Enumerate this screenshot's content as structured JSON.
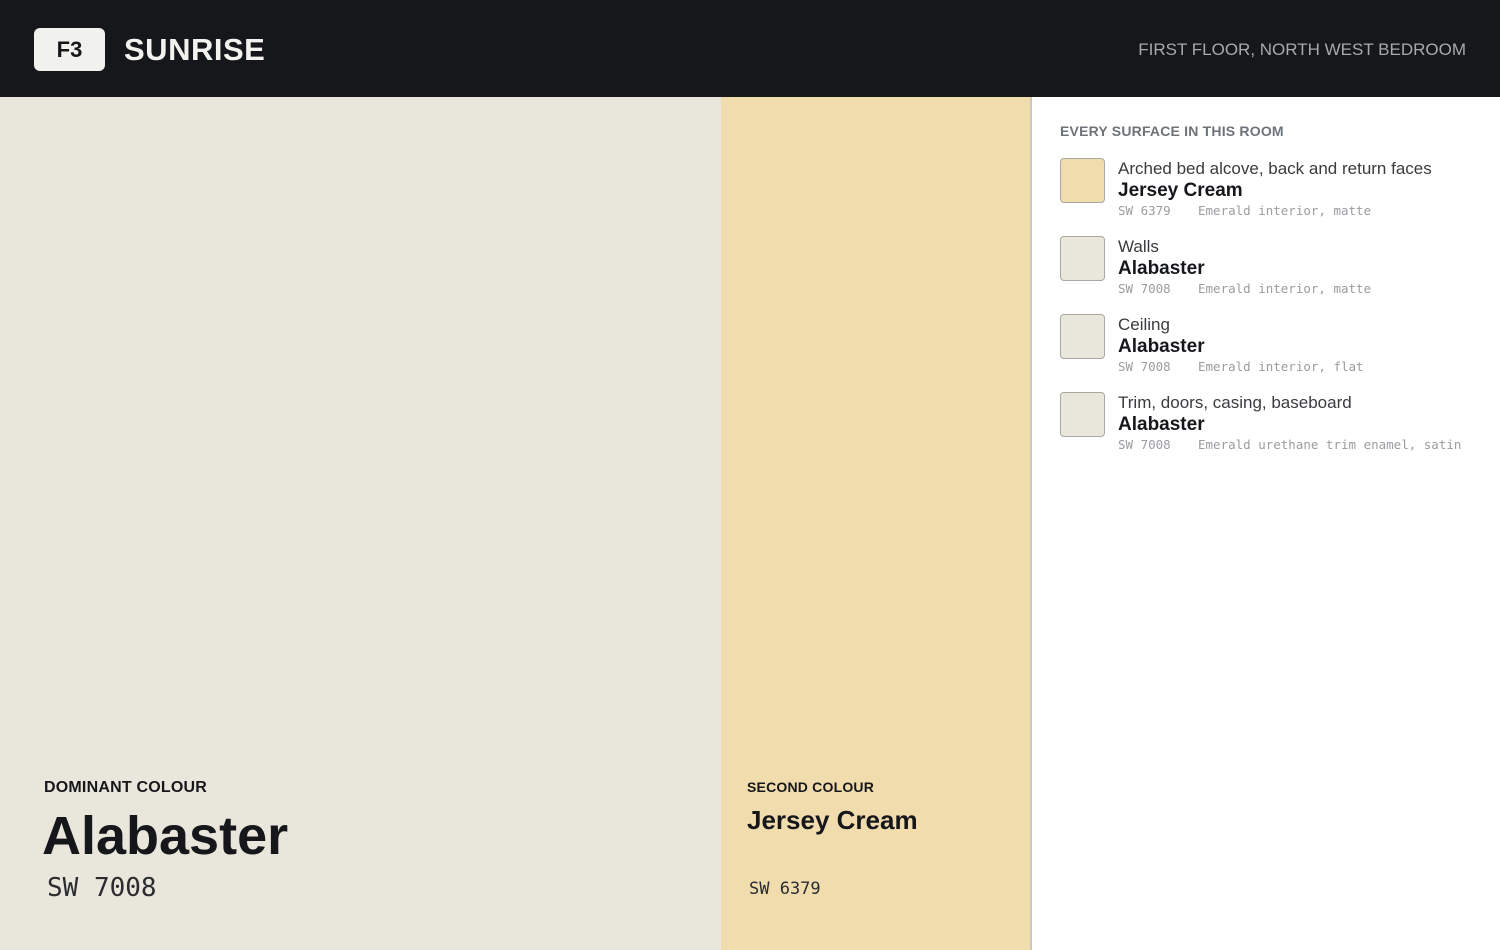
{
  "header": {
    "floor_badge": "F3",
    "app_title": "SUNRISE",
    "location": "FIRST FLOOR, NORTH WEST BEDROOM"
  },
  "dominant": {
    "kicker": "DOMINANT COLOUR",
    "name": "Alabaster",
    "code": "SW 7008",
    "color": "#e9e6dc"
  },
  "second": {
    "kicker": "SECOND COLOUR",
    "name": "Jersey Cream",
    "code": "SW 6379",
    "color": "#f0dcad"
  },
  "panel": {
    "heading": "EVERY SURFACE IN THIS ROOM",
    "surfaces": [
      {
        "label": "Arched bed alcove, back and return faces",
        "colour_name": "Jersey Cream",
        "code": "SW 6379",
        "finish": "Emerald interior, matte",
        "swatch_color": "#f0dcad"
      },
      {
        "label": "Walls",
        "colour_name": "Alabaster",
        "code": "SW 7008",
        "finish": "Emerald interior, matte",
        "swatch_color": "#e9e6dc"
      },
      {
        "label": "Ceiling",
        "colour_name": "Alabaster",
        "code": "SW 7008",
        "finish": "Emerald interior, flat",
        "swatch_color": "#e9e6dc"
      },
      {
        "label": "Trim, doors, casing, baseboard",
        "colour_name": "Alabaster",
        "code": "SW 7008",
        "finish": "Emerald urethane trim enamel, satin",
        "swatch_color": "#e9e6dc"
      }
    ]
  }
}
